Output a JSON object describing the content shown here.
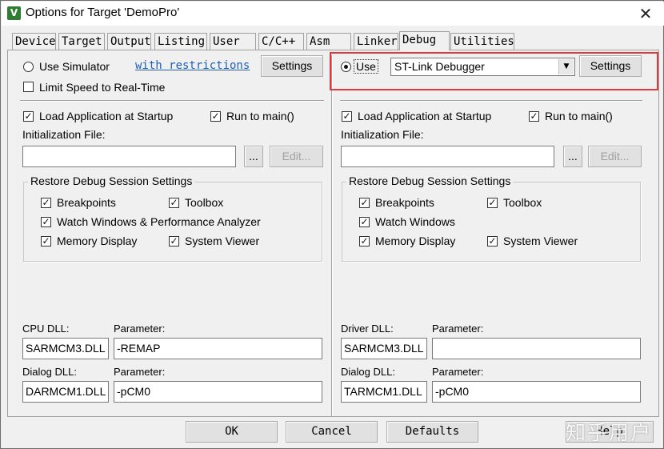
{
  "window": {
    "title": "Options for Target 'DemoPro'",
    "app_icon": "keil-uvision-icon",
    "close_glyph": "✕"
  },
  "tabs": [
    {
      "label": "Device"
    },
    {
      "label": "Target"
    },
    {
      "label": "Output"
    },
    {
      "label": "Listing"
    },
    {
      "label": "User"
    },
    {
      "label": "C/C++"
    },
    {
      "label": "Asm"
    },
    {
      "label": "Linker"
    },
    {
      "label": "Debug",
      "active": true
    },
    {
      "label": "Utilities"
    }
  ],
  "left": {
    "use_simulator": {
      "label": "Use Simulator",
      "selected": false
    },
    "restrictions_link": "with restrictions",
    "settings_button": "Settings",
    "limit_speed": {
      "label": "Limit Speed to Real-Time",
      "checked": false
    },
    "load_app": {
      "label": "Load Application at Startup",
      "checked": true
    },
    "run_to_main": {
      "label": "Run to main()",
      "checked": true
    },
    "init_file_label": "Initialization File:",
    "init_file_value": "",
    "browse_button": "...",
    "edit_button": "Edit...",
    "restore_group": {
      "title": "Restore Debug Session Settings",
      "breakpoints": {
        "label": "Breakpoints",
        "checked": true
      },
      "toolbox": {
        "label": "Toolbox",
        "checked": true
      },
      "watch_windows": {
        "label": "Watch Windows & Performance Analyzer",
        "checked": true
      },
      "memory_display": {
        "label": "Memory Display",
        "checked": true
      },
      "system_viewer": {
        "label": "System Viewer",
        "checked": true
      }
    },
    "dll1_label": "CPU DLL:",
    "dll1_value": "SARMCM3.DLL",
    "param1_label": "Parameter:",
    "param1_value": "-REMAP",
    "dll2_label": "Dialog DLL:",
    "dll2_value": "DARMCM1.DLL",
    "param2_label": "Parameter:",
    "param2_value": "-pCM0"
  },
  "right": {
    "use": {
      "label": "Use",
      "selected": true
    },
    "debugger_select": "ST-Link Debugger",
    "settings_button": "Settings",
    "load_app": {
      "label": "Load Application at Startup",
      "checked": true
    },
    "run_to_main": {
      "label": "Run to main()",
      "checked": true
    },
    "init_file_label": "Initialization File:",
    "init_file_value": "",
    "browse_button": "...",
    "edit_button": "Edit...",
    "restore_group": {
      "title": "Restore Debug Session Settings",
      "breakpoints": {
        "label": "Breakpoints",
        "checked": true
      },
      "toolbox": {
        "label": "Toolbox",
        "checked": true
      },
      "watch_windows": {
        "label": "Watch Windows",
        "checked": true
      },
      "memory_display": {
        "label": "Memory Display",
        "checked": true
      },
      "system_viewer": {
        "label": "System Viewer",
        "checked": true
      }
    },
    "dll1_label": "Driver DLL:",
    "dll1_value": "SARMCM3.DLL",
    "param1_label": "Parameter:",
    "param1_value": "",
    "dll2_label": "Dialog DLL:",
    "dll2_value": "TARMCM1.DLL",
    "param2_label": "Parameter:",
    "param2_value": "-pCM0"
  },
  "footer": {
    "ok": "OK",
    "cancel": "Cancel",
    "defaults": "Defaults",
    "help": "Help"
  },
  "watermark": "知乎用户",
  "colors": {
    "highlight": "#e0383b",
    "link": "#1f5fb8"
  }
}
